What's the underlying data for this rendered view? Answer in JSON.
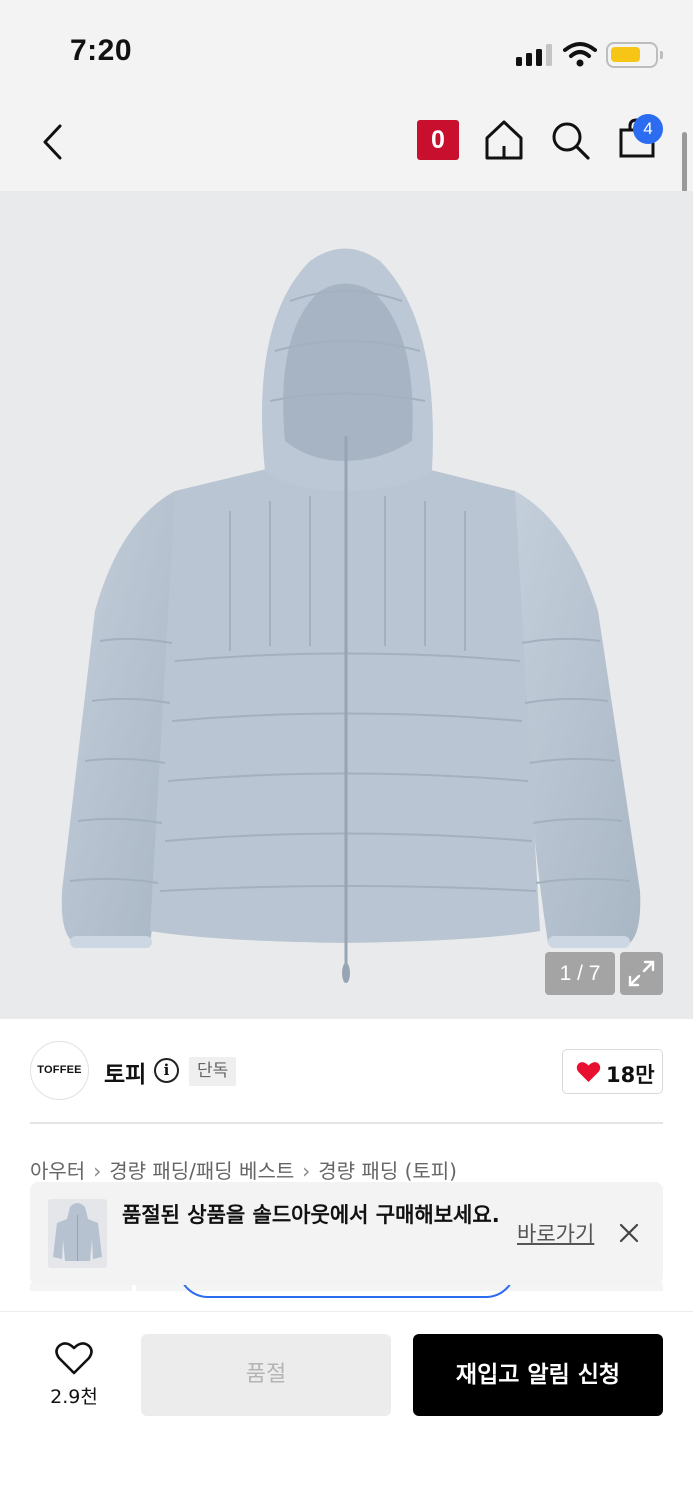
{
  "status_bar": {
    "time": "7:20",
    "battery_color": "#f6c515"
  },
  "nav": {
    "zero_badge": "0",
    "bag_count": "4",
    "accent": "#c8102e",
    "badge_color": "#2b6cf0",
    "icons": [
      "back-chevron-icon",
      "home-icon",
      "search-icon",
      "shopping-bag-icon"
    ]
  },
  "gallery": {
    "counter": "1 / 7",
    "image": "light-blue hooded lightweight padded jacket"
  },
  "brand": {
    "logo_text": "TOFFEE",
    "name": "토피",
    "badge": "단독",
    "likes": "18만"
  },
  "breadcrumb": [
    "아우터",
    "경량 패딩/패딩 베스트",
    "경량 패딩 (토피)"
  ],
  "toast": {
    "message": "품절된 상품을 솔드아웃에서 구매해보세요.",
    "link": "바로가기"
  },
  "bottom_bar": {
    "wish_count": "2.9천",
    "soldout_label": "품절",
    "restock_label": "재입고 알림 신청"
  }
}
